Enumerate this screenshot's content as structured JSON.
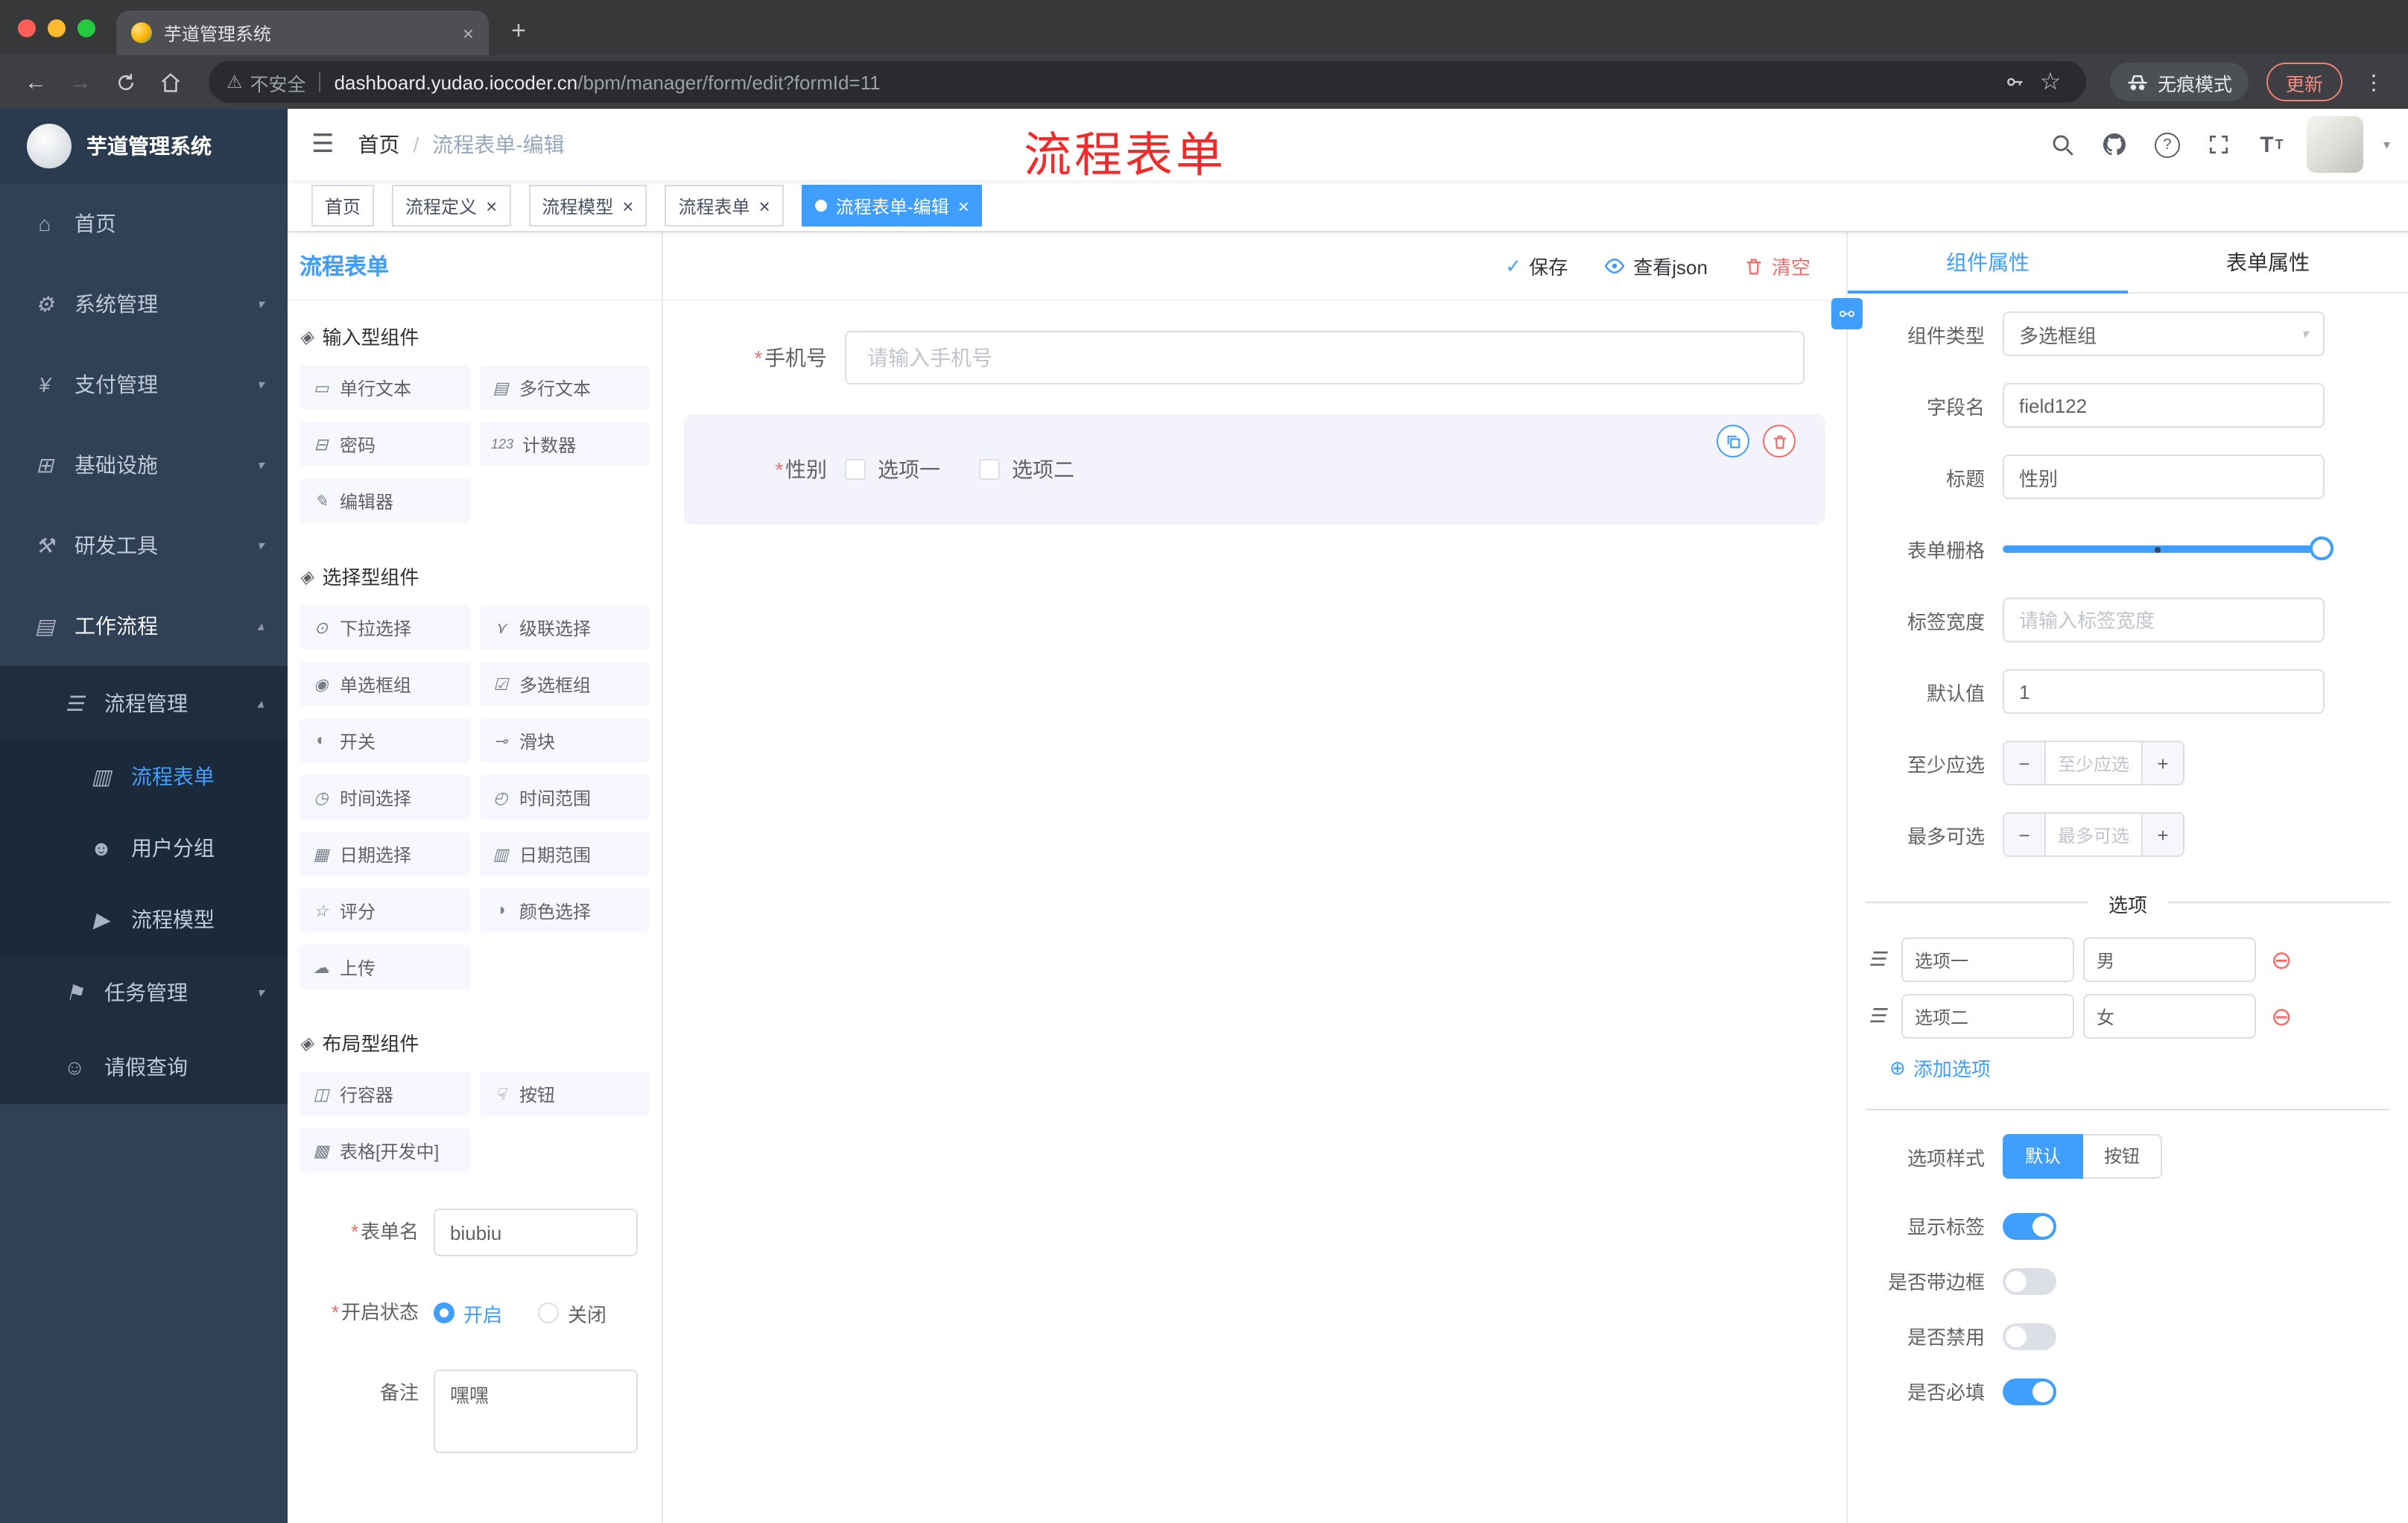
{
  "browser": {
    "tab_title": "芋道管理系统",
    "security_label": "不安全",
    "url_host": "dashboard.yudao.iocoder.cn",
    "url_path": "/bpm/manager/form/edit?formId=11",
    "incognito_label": "无痕模式",
    "update_label": "更新"
  },
  "annotation": {
    "text": "流程表单"
  },
  "sidebar": {
    "logo_title": "芋道管理系统",
    "items": [
      {
        "label": "首页",
        "icon": "⌂"
      },
      {
        "label": "系统管理",
        "icon": "⚙"
      },
      {
        "label": "支付管理",
        "icon": "¥"
      },
      {
        "label": "基础设施",
        "icon": "⊞"
      },
      {
        "label": "研发工具",
        "icon": "⚒"
      },
      {
        "label": "工作流程",
        "icon": "▤"
      }
    ],
    "submenu": {
      "manage": {
        "label": "流程管理",
        "icon": "☰"
      },
      "children": [
        {
          "label": "流程表单",
          "icon": "▥"
        },
        {
          "label": "用户分组",
          "icon": "☻"
        },
        {
          "label": "流程模型",
          "icon": "▶"
        }
      ],
      "task": {
        "label": "任务管理",
        "icon": "⚑"
      },
      "leave": {
        "label": "请假查询",
        "icon": "☺"
      }
    }
  },
  "navbar": {
    "breadcrumb_home": "首页",
    "breadcrumb_sep": "/",
    "breadcrumb_current": "流程表单-编辑"
  },
  "tags": [
    {
      "label": "首页"
    },
    {
      "label": "流程定义"
    },
    {
      "label": "流程模型"
    },
    {
      "label": "流程表单"
    },
    {
      "label": "流程表单-编辑"
    }
  ],
  "builder": {
    "title": "流程表单",
    "save": "保存",
    "view_json": "查看json",
    "clear": "清空"
  },
  "palette": {
    "groups": [
      {
        "title": "输入型组件",
        "items": [
          {
            "icon": "▭",
            "label": "单行文本"
          },
          {
            "icon": "▤",
            "label": "多行文本"
          },
          {
            "icon": "⊟",
            "label": "密码"
          },
          {
            "icon": "123",
            "label": "计数器"
          },
          {
            "icon": "✎",
            "label": "编辑器"
          }
        ]
      },
      {
        "title": "选择型组件",
        "items": [
          {
            "icon": "⊙",
            "label": "下拉选择"
          },
          {
            "icon": "⋎",
            "label": "级联选择"
          },
          {
            "icon": "◉",
            "label": "单选框组"
          },
          {
            "icon": "☑",
            "label": "多选框组"
          },
          {
            "icon": "◐",
            "label": "开关"
          },
          {
            "icon": "⊸",
            "label": "滑块"
          },
          {
            "icon": "◷",
            "label": "时间选择"
          },
          {
            "icon": "◴",
            "label": "时间范围"
          },
          {
            "icon": "▦",
            "label": "日期选择"
          },
          {
            "icon": "▥",
            "label": "日期范围"
          },
          {
            "icon": "☆",
            "label": "评分"
          },
          {
            "icon": "◑",
            "label": "颜色选择"
          },
          {
            "icon": "☁",
            "label": "上传"
          }
        ]
      },
      {
        "title": "布局型组件",
        "items": [
          {
            "icon": "◫",
            "label": "行容器"
          },
          {
            "icon": "☟",
            "label": "按钮"
          },
          {
            "icon": "▩",
            "label": "表格[开发中]"
          }
        ]
      }
    ],
    "form": {
      "name_label": "表单名",
      "name_value": "biubiu",
      "status_label": "开启状态",
      "status_on": "开启",
      "status_off": "关闭",
      "remark_label": "备注",
      "remark_value": "嘿嘿"
    }
  },
  "canvas": {
    "phone_label": "手机号",
    "phone_placeholder": "请输入手机号",
    "gender_label": "性别",
    "gender_options": [
      "选项一",
      "选项二"
    ]
  },
  "props": {
    "tab_component": "组件属性",
    "tab_form": "表单属性",
    "type_label": "组件类型",
    "type_value": "多选框组",
    "field_label": "字段名",
    "field_value": "field122",
    "title_label": "标题",
    "title_value": "性别",
    "grid_label": "表单栅格",
    "width_label": "标签宽度",
    "width_placeholder": "请输入标签宽度",
    "default_label": "默认值",
    "default_value": "1",
    "min_label": "至少应选",
    "min_placeholder": "至少应选",
    "max_label": "最多可选",
    "max_placeholder": "最多可选",
    "options_divider": "选项",
    "option_rows": [
      {
        "name": "选项一",
        "value": "男"
      },
      {
        "name": "选项二",
        "value": "女"
      }
    ],
    "add_option": "添加选项",
    "style_label": "选项样式",
    "style_default": "默认",
    "style_button": "按钮",
    "switches": [
      {
        "label": "显示标签",
        "on": true
      },
      {
        "label": "是否带边框",
        "on": false
      },
      {
        "label": "是否禁用",
        "on": false
      },
      {
        "label": "是否必填",
        "on": true
      }
    ]
  },
  "misc": {
    "required": "*",
    "close": "×",
    "chevron_down": "▾",
    "chevron_up": "▴",
    "select_arrow": "▾",
    "check": "✓",
    "add_circle": "⊕",
    "remove_circle": "⊖",
    "minus": "−",
    "plus": "+",
    "new_tab": "+",
    "ellipsis": "⋮",
    "back": "←",
    "forward": "→",
    "star": "☆",
    "warning": "⚠",
    "hamburger": "☰",
    "drag": "☰",
    "link": "⚯",
    "group_icon": "◈",
    "question": "?",
    "font_big": "T",
    "font_small": "T"
  },
  "colors": {
    "primary": "#409eff",
    "danger": "#f56c6c",
    "sidebar_bg": "#304156",
    "annotation_red": "#ef2b2b",
    "active_tag_bg": "#409eff"
  }
}
